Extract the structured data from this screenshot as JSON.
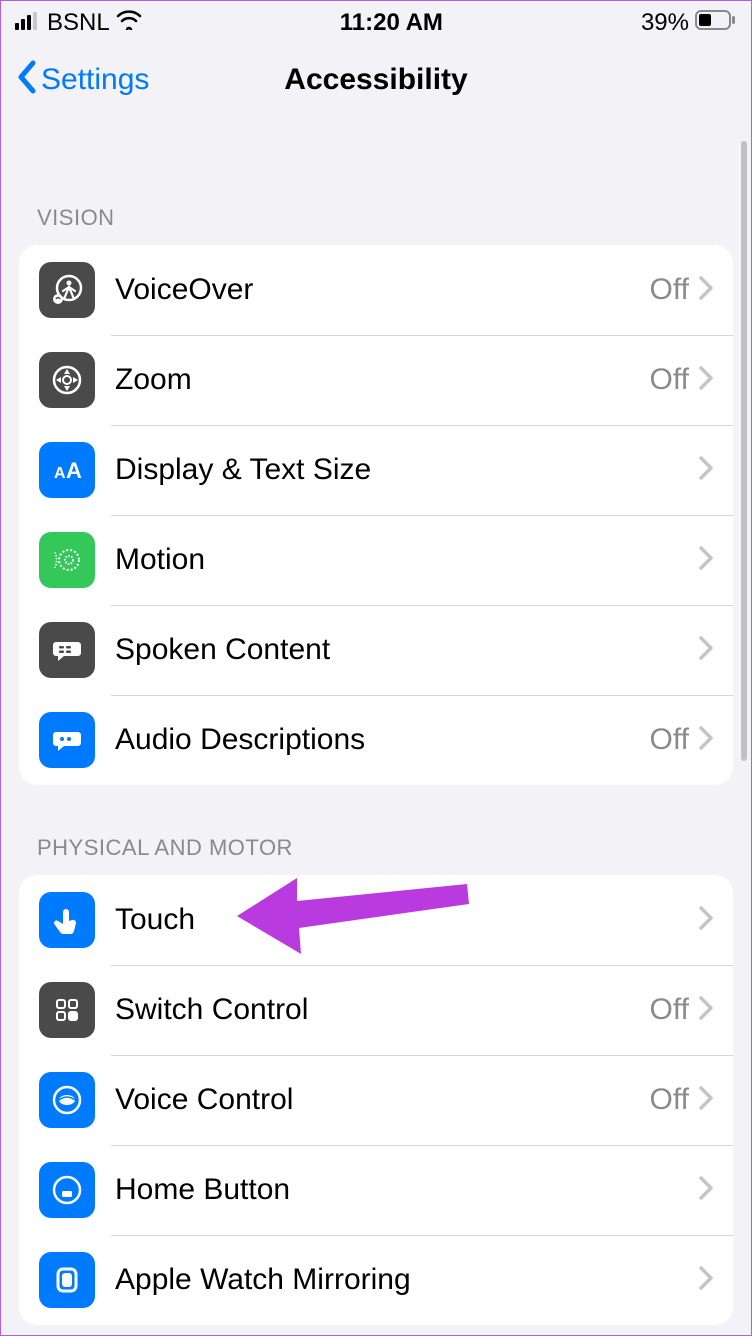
{
  "status_bar": {
    "carrier": "BSNL",
    "time": "11:20 AM",
    "battery_pct": "39%"
  },
  "nav": {
    "back_label": "Settings",
    "title": "Accessibility"
  },
  "sections": {
    "vision": {
      "header": "VISION",
      "items": [
        {
          "label": "VoiceOver",
          "value": "Off"
        },
        {
          "label": "Zoom",
          "value": "Off"
        },
        {
          "label": "Display & Text Size",
          "value": ""
        },
        {
          "label": "Motion",
          "value": ""
        },
        {
          "label": "Spoken Content",
          "value": ""
        },
        {
          "label": "Audio Descriptions",
          "value": "Off"
        }
      ]
    },
    "physical": {
      "header": "PHYSICAL AND MOTOR",
      "items": [
        {
          "label": "Touch",
          "value": ""
        },
        {
          "label": "Switch Control",
          "value": "Off"
        },
        {
          "label": "Voice Control",
          "value": "Off"
        },
        {
          "label": "Home Button",
          "value": ""
        },
        {
          "label": "Apple Watch Mirroring",
          "value": ""
        }
      ]
    }
  },
  "annotation": {
    "arrow_color": "#b93bdf"
  }
}
